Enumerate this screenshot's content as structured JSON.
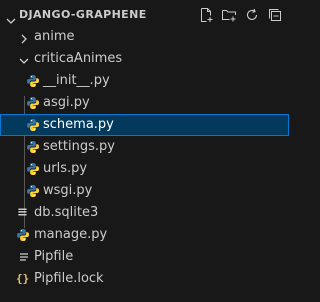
{
  "explorer": {
    "title": "DJANGO-GRAPHENE",
    "actions": [
      {
        "name": "new-file-icon"
      },
      {
        "name": "new-folder-icon"
      },
      {
        "name": "refresh-icon"
      },
      {
        "name": "collapse-all-icon"
      }
    ]
  },
  "tree": [
    {
      "label": "anime",
      "type": "folder",
      "expanded": false,
      "depth": 0
    },
    {
      "label": "criticaAnimes",
      "type": "folder",
      "expanded": true,
      "depth": 0
    },
    {
      "label": "__init__.py",
      "type": "python",
      "depth": 1
    },
    {
      "label": "asgi.py",
      "type": "python",
      "depth": 1
    },
    {
      "label": "schema.py",
      "type": "python",
      "depth": 1,
      "selected": true
    },
    {
      "label": "settings.py",
      "type": "python",
      "depth": 1
    },
    {
      "label": "urls.py",
      "type": "python",
      "depth": 1
    },
    {
      "label": "wsgi.py",
      "type": "python",
      "depth": 1
    },
    {
      "label": "db.sqlite3",
      "type": "database",
      "depth": 0
    },
    {
      "label": "manage.py",
      "type": "python",
      "depth": 0
    },
    {
      "label": "Pipfile",
      "type": "file",
      "depth": 0
    },
    {
      "label": "Pipfile.lock",
      "type": "lock",
      "depth": 0
    }
  ],
  "colors": {
    "background": "#181818",
    "selection": "#04395e",
    "selection_border": "#0078d4",
    "python_blue": "#3776ab",
    "python_yellow": "#ffd43b"
  }
}
